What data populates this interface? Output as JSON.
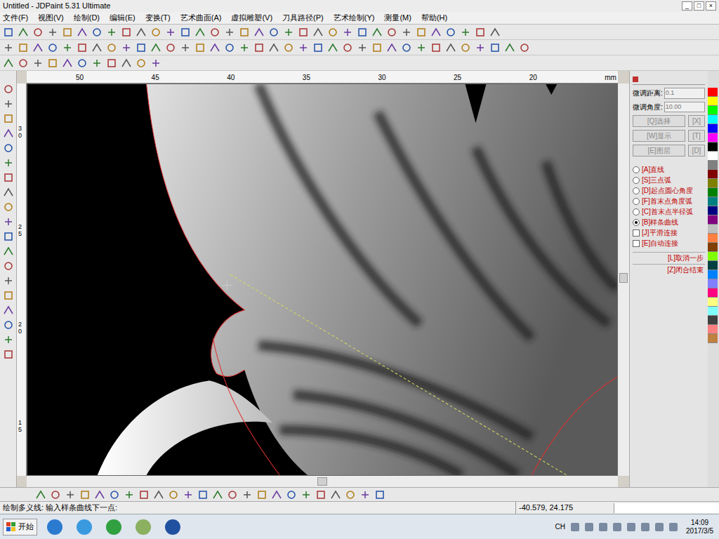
{
  "window": {
    "title": "Untitled - JDPaint 5.31 Ultimate",
    "controls": [
      "_",
      "□",
      "×"
    ]
  },
  "menu": [
    "文件(F)",
    "视图(V)",
    "绘制(D)",
    "编辑(E)",
    "变换(T)",
    "艺术曲面(A)",
    "虚拟雕塑(V)",
    "刀具路径(P)",
    "艺术绘制(Y)",
    "测量(M)",
    "帮助(H)"
  ],
  "ruler_top": [
    "50",
    "45",
    "40",
    "35",
    "30",
    "25",
    "20",
    "mm"
  ],
  "ruler_left": [
    "30",
    "25",
    "20",
    "15"
  ],
  "panel": {
    "fields": [
      {
        "label": "微调距离:",
        "value": "0.1"
      },
      {
        "label": "微调角度:",
        "value": "10.00"
      }
    ],
    "button_rows": [
      [
        "[Q]选择",
        "[X]"
      ],
      [
        "[W]显示",
        "[T]"
      ],
      [
        "[E]图层",
        "[D]"
      ]
    ],
    "options": [
      {
        "label": "[A]直线",
        "kind": "radio",
        "selected": false
      },
      {
        "label": "[S]三点弧",
        "kind": "radio",
        "selected": false
      },
      {
        "label": "[D]起点圆心角度",
        "kind": "radio",
        "selected": false
      },
      {
        "label": "[F]首末点角度弧",
        "kind": "radio",
        "selected": false
      },
      {
        "label": "[C]首末点半径弧",
        "kind": "radio",
        "selected": false
      },
      {
        "label": "[B]样条曲线",
        "kind": "radio",
        "selected": true
      },
      {
        "label": "[J]平滑连接",
        "kind": "checkbox",
        "selected": false
      },
      {
        "label": "[E]自动连接",
        "kind": "checkbox",
        "selected": false
      }
    ],
    "actions": [
      "[L]取消一步",
      "[Z]闭合结束"
    ]
  },
  "palette": [
    "#ff0000",
    "#ffff00",
    "#00ff00",
    "#00ffff",
    "#0000ff",
    "#ff00ff",
    "#000000",
    "#ffffff",
    "#808080",
    "#800000",
    "#808000",
    "#008000",
    "#008080",
    "#000080",
    "#800080",
    "#c0c0c0",
    "#ff8040",
    "#804000",
    "#80ff00",
    "#004040",
    "#0080ff",
    "#8080ff",
    "#ff0080",
    "#ffff80",
    "#80ffff",
    "#404040",
    "#ff8080",
    "#c08040"
  ],
  "status": {
    "prompt": "绘制多义线: 输入样条曲线下一点:",
    "coords": "-40.579, 24.175"
  },
  "taskbar": {
    "start": "开始",
    "lang": "CH",
    "time": "14:09",
    "date": "2017/3/5"
  }
}
